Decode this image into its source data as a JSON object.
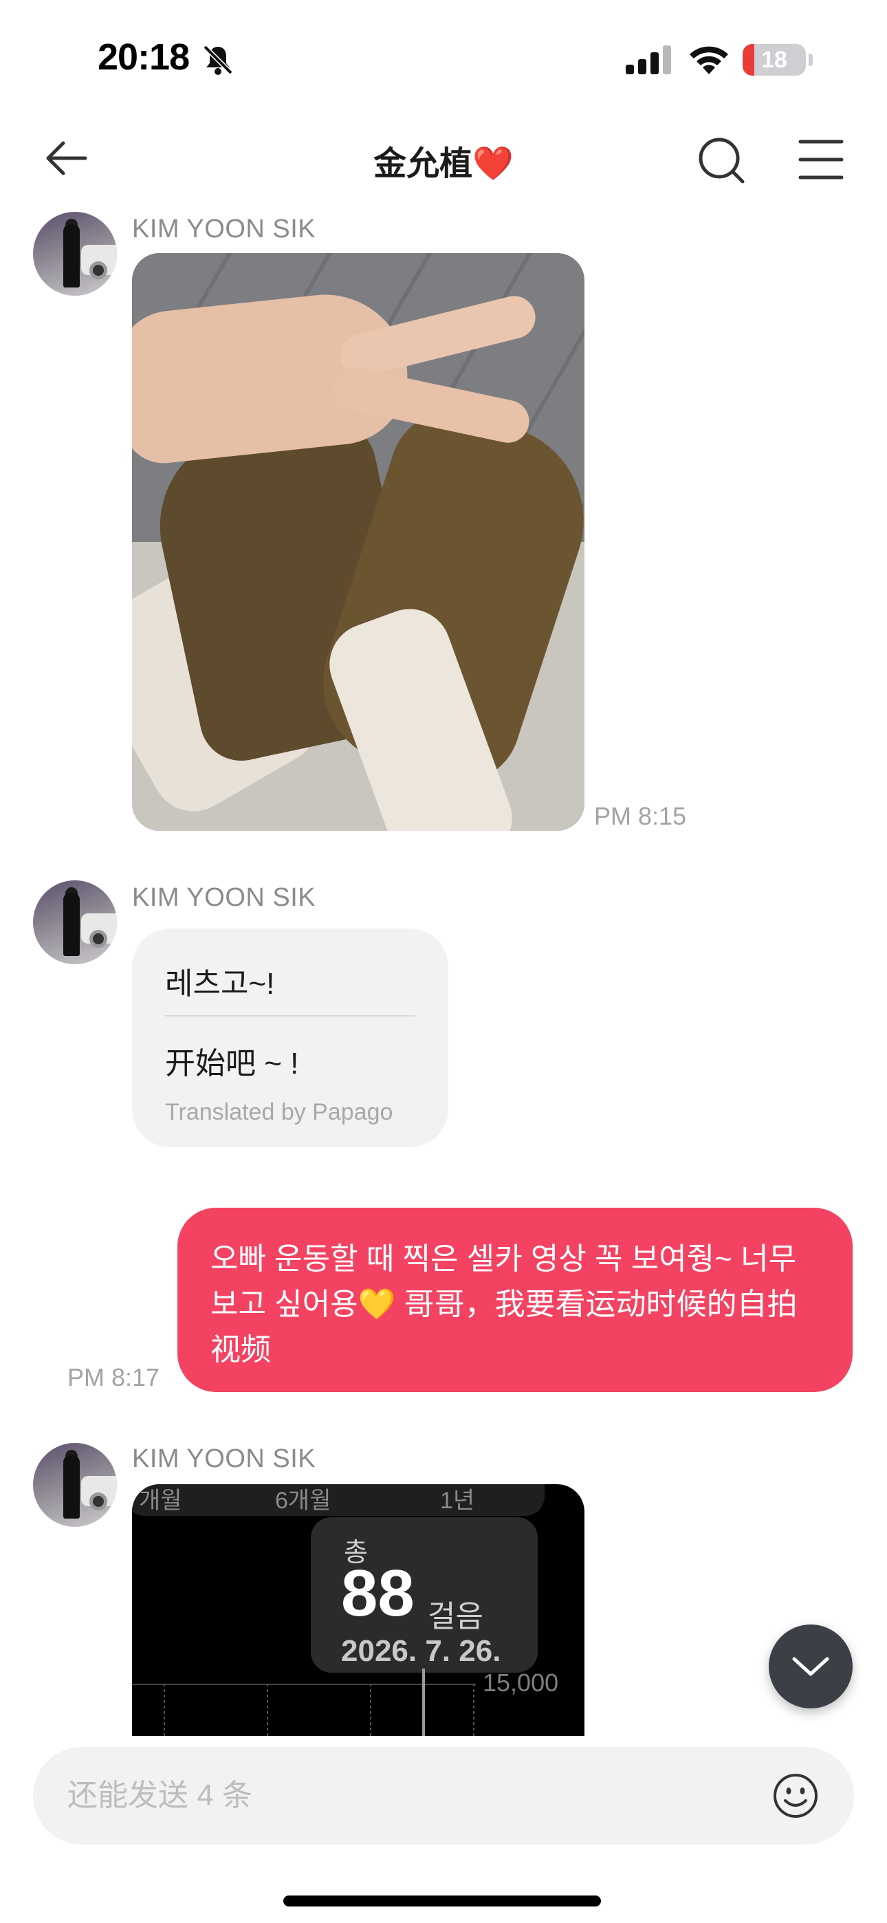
{
  "status_bar": {
    "time": "20:18",
    "battery": "18",
    "battery_level": 0.18,
    "icons": [
      "bell-slash-icon",
      "cellular-signal-icon",
      "wifi-icon",
      "battery-icon"
    ]
  },
  "header": {
    "title": "金允植",
    "title_emoji": "❤️",
    "icons": [
      "back-arrow-icon",
      "search-icon",
      "menu-icon"
    ]
  },
  "messages": [
    {
      "type": "photo",
      "sender": "KIM YOON SIK",
      "time": "PM 8:15"
    },
    {
      "type": "translated_text",
      "sender": "KIM YOON SIK",
      "original": "레츠고~!",
      "translation": "开始吧 ~ !",
      "credit": "Translated by Papago"
    },
    {
      "type": "sent_text",
      "time": "PM 8:17",
      "text": "오빠 운동할 때 찍은 셀카 영상 꼭 보여줭~ 너무 보고 싶어용💛 哥哥，我要看运动时候的自拍视频"
    },
    {
      "type": "image",
      "sender": "KIM YOON SIK",
      "steps_card": {
        "tab_labels": [
          "개월",
          "6개월",
          "1년"
        ],
        "total_label": "총",
        "count": "88",
        "unit": "걸음",
        "date": "2026. 7. 26.",
        "axis_label": "15,000"
      }
    }
  ],
  "input": {
    "placeholder": "还能发送 4 条",
    "value": ""
  },
  "colors": {
    "sent_bubble": "#f44362",
    "received_bubble": "#f2f2f4",
    "heart": "#e8262f",
    "battery_low": "#ea3b3b"
  }
}
